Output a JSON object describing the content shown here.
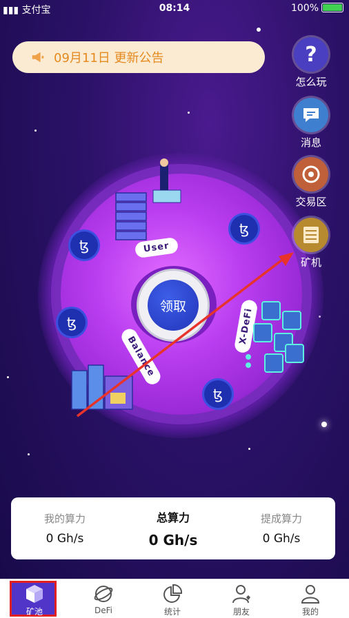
{
  "status_bar": {
    "carrier": "支付宝",
    "time": "08:14",
    "battery": "100%"
  },
  "notice": {
    "text": "09月11日  更新公告",
    "icon": "megaphone-icon"
  },
  "side_menu": [
    {
      "label": "怎么玩",
      "icon": "question-icon",
      "color": "#4a3fc0"
    },
    {
      "label": "消息",
      "icon": "message-icon",
      "color": "#3f7fd0"
    },
    {
      "label": "交易区",
      "icon": "exchange-icon",
      "color": "#c0603a"
    },
    {
      "label": "矿机",
      "icon": "server-icon",
      "color": "#b88a30"
    }
  ],
  "planet": {
    "claim_button": "领取",
    "labels": {
      "user": "User",
      "defi": "X-DeFi",
      "balance": "Balance"
    }
  },
  "stats": {
    "my_hashrate": {
      "label": "我的算力",
      "value": "0 Gh/s"
    },
    "total_hashrate": {
      "label": "总算力",
      "value": "0 Gh/s"
    },
    "withdraw_hashrate": {
      "label": "提成算力",
      "value": "0 Gh/s"
    }
  },
  "tabs": [
    {
      "label": "矿池",
      "icon": "cube-icon",
      "active": true
    },
    {
      "label": "DeFi",
      "icon": "planet-icon",
      "active": false
    },
    {
      "label": "统计",
      "icon": "pie-chart-icon",
      "active": false
    },
    {
      "label": "朋友",
      "icon": "friends-icon",
      "active": false
    },
    {
      "label": "我的",
      "icon": "user-icon",
      "active": false
    }
  ],
  "colors": {
    "accent": "#5135c8",
    "notice_text": "#e58a1f",
    "highlight_border": "#e02020",
    "arrow": "#e8332a"
  }
}
